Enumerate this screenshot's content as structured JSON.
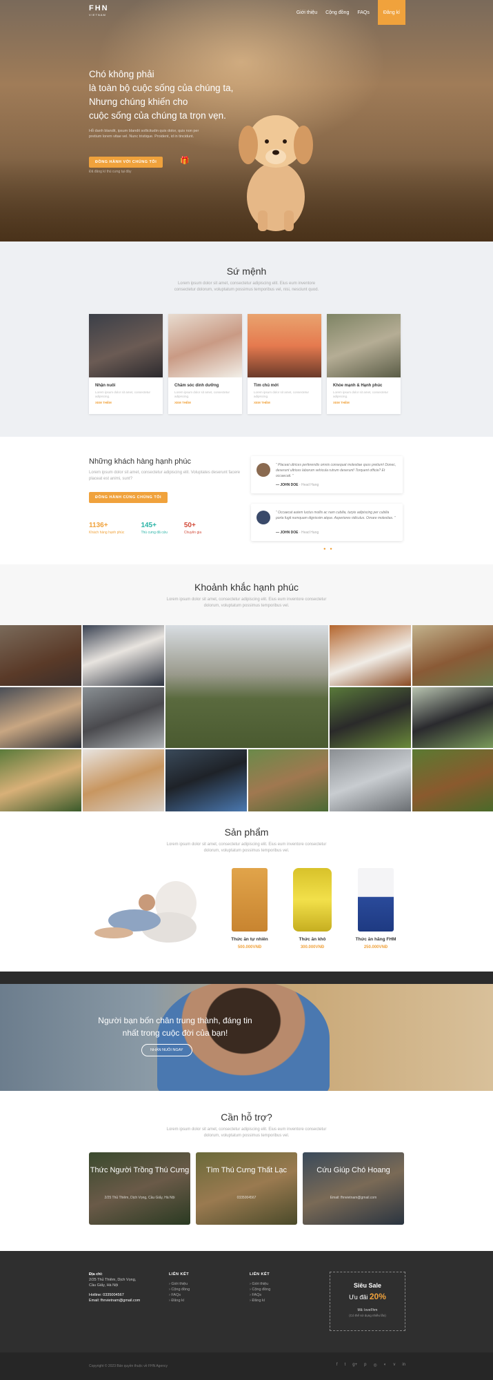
{
  "header": {
    "logo": "FHN",
    "logo_sub": "VIETNAM",
    "nav": [
      "Giới thiệu",
      "Cộng đồng",
      "FAQs"
    ],
    "cta": "Đăng kí"
  },
  "hero": {
    "title_lines": [
      "Chó không phải",
      "là toàn bộ cuộc sống của chúng ta,",
      "Nhưng chúng khiến cho",
      "cuộc sống của chúng ta trọn vẹn."
    ],
    "lead": "Hỗ danh blandit, ipsum blandit sollicitudin quis dolor, quis non per pretium lorem vitae vel. Nunc tristique. Proident, id in tincidunt.",
    "button": "ĐỒNG HÀNH VỚI CHÚNG TÔI",
    "gift_icon": "gift-icon",
    "note": "Đã đăng kí thú cưng tại đây"
  },
  "mission": {
    "title": "Sứ mệnh",
    "subtitle": "Lorem ipsum dolor sit amet, consectetur adipiscing elit. Eius eum inventore consectetur dolorum, voluptatum possimus temporibus vel, nisi, nesciunt quod.",
    "cards": [
      {
        "title": "Nhận nuôi",
        "desc": "Lorem ipsum dolor sit amet, consectetur adipiscing.",
        "more": "XEM THÊM"
      },
      {
        "title": "Chăm sóc dinh dưỡng",
        "desc": "Lorem ipsum dolor sit amet, consectetur adipiscing.",
        "more": "XEM THÊM"
      },
      {
        "title": "Tìm chủ mới",
        "desc": "Lorem ipsum dolor sit amet, consectetur adipiscing.",
        "more": "XEM THÊM"
      },
      {
        "title": "Khỏe mạnh & Hạnh phúc",
        "desc": "Lorem ipsum dolor sit amet, consectetur adipiscing.",
        "more": "XEM THÊM"
      }
    ]
  },
  "customers": {
    "title": "Những khách hàng hạnh phúc",
    "desc": "Lorem ipsum dolor sit amet, consectetur adipiscing elit. Voluptates deserunt facere placeat est animi, sunt?",
    "button": "ĐỒNG HÀNH CÙNG CHÚNG TÔI",
    "stats": [
      {
        "number": "1136+",
        "label": "Khách hàng hạnh phúc",
        "color": "#f0a23c"
      },
      {
        "number": "145+",
        "label": "Thú cưng đã cứu",
        "color": "#2ab3a6"
      },
      {
        "number": "50+",
        "label": "Chuyên gia",
        "color": "#d24b3a"
      }
    ],
    "testimonials": [
      {
        "quote": "“ Placeat ultrices perferendis omnis consequat molestiae quos pretium! Donec, deserunt ultrices laborum vehicula rutrum deserunt! Torquent officia? Et occaecati. ”",
        "author": "— JOHN DOE",
        "role": " - Head Hang"
      },
      {
        "quote": "“ Occaecat autem luctus mollis ac nam cubilia, turpis adipiscing per cubilia porta fugit numquam dignissim atque. Asperiores ridiculus. Ornare molestias. ”",
        "author": "— JOHN DOE",
        "role": " - Head Hang"
      }
    ],
    "dots": "● ●"
  },
  "moments": {
    "title": "Khoảnh khắc hạnh phúc",
    "subtitle": "Lorem ipsum dolor sit amet, consectetur adipiscing elit. Eius eum inventore consectetur dolorum, voluptatum possimus temporibus vel."
  },
  "products": {
    "title": "Sản phẩm",
    "subtitle": "Lorem ipsum dolor sit amet, consectetur adipiscing elit. Eius eum inventore consectetur dolorum, voluptatum possimus temporibus vel.",
    "items": [
      {
        "name": "Thức ăn tự nhiên",
        "price": "500.000VNĐ"
      },
      {
        "name": "Thức ăn khô",
        "price": "300.000VNĐ"
      },
      {
        "name": "Thức ăn hãng FHM",
        "price": "250.000VNĐ"
      }
    ]
  },
  "banner": {
    "text": "Người bạn bốn chân trung thành, đáng tin nhất trong cuộc đời của bạn!",
    "button": "NHẬN NUÔI NGAY"
  },
  "support": {
    "title": "Cần hỗ trợ?",
    "subtitle": "Lorem ipsum dolor sit amet, consectetur adipiscing elit. Eius eum inventore consectetur dolorum, voluptatum possimus temporibus vel.",
    "cards": [
      {
        "title": "Thức Người Trồng Thú Cưng",
        "info": "2/25 Thủ Thiêm, Dịch Vọng, Cầu Giấy, Hà Nội"
      },
      {
        "title": "Tìm Thú Cưng Thất Lạc",
        "info": "0335004567"
      },
      {
        "title": "Cứu Giúp Chó Hoang",
        "info": "Email: fhnvietnam@gmail.com"
      }
    ]
  },
  "footer": {
    "address_label": "Địa chỉ:",
    "address_lines": [
      "2/25 Thủ Thiêm, Dịch Vọng,",
      "Cầu Giấy, Hà Nội"
    ],
    "hotline": "Hotline: 0335004567",
    "email": "Email: fhnvietnam@gmail.com",
    "links_title_1": "LIÊN KẾT",
    "links_1": [
      "Giới thiệu",
      "Cộng đồng",
      "FAQs",
      "Đăng kí"
    ],
    "links_title_2": "LIÊN KẾT",
    "links_2": [
      "Giới thiệu",
      "Cộng đồng",
      "FAQs",
      "Đăng kí"
    ],
    "sale_title": "Siêu Sale",
    "sale_text": "Ưu đãi",
    "sale_percent": "20%",
    "sale_code": "Mã: loveFhm",
    "sale_note": "(Có thể sử dụng nhiều lần)",
    "copyright": "Copyright © 2023 Bản quyền thuộc về FHN Agency",
    "social_icons": [
      "facebook-icon",
      "twitter-icon",
      "google-plus-icon",
      "pinterest-icon",
      "instagram-icon",
      "github-icon",
      "vimeo-icon",
      "linkedin-icon"
    ]
  }
}
